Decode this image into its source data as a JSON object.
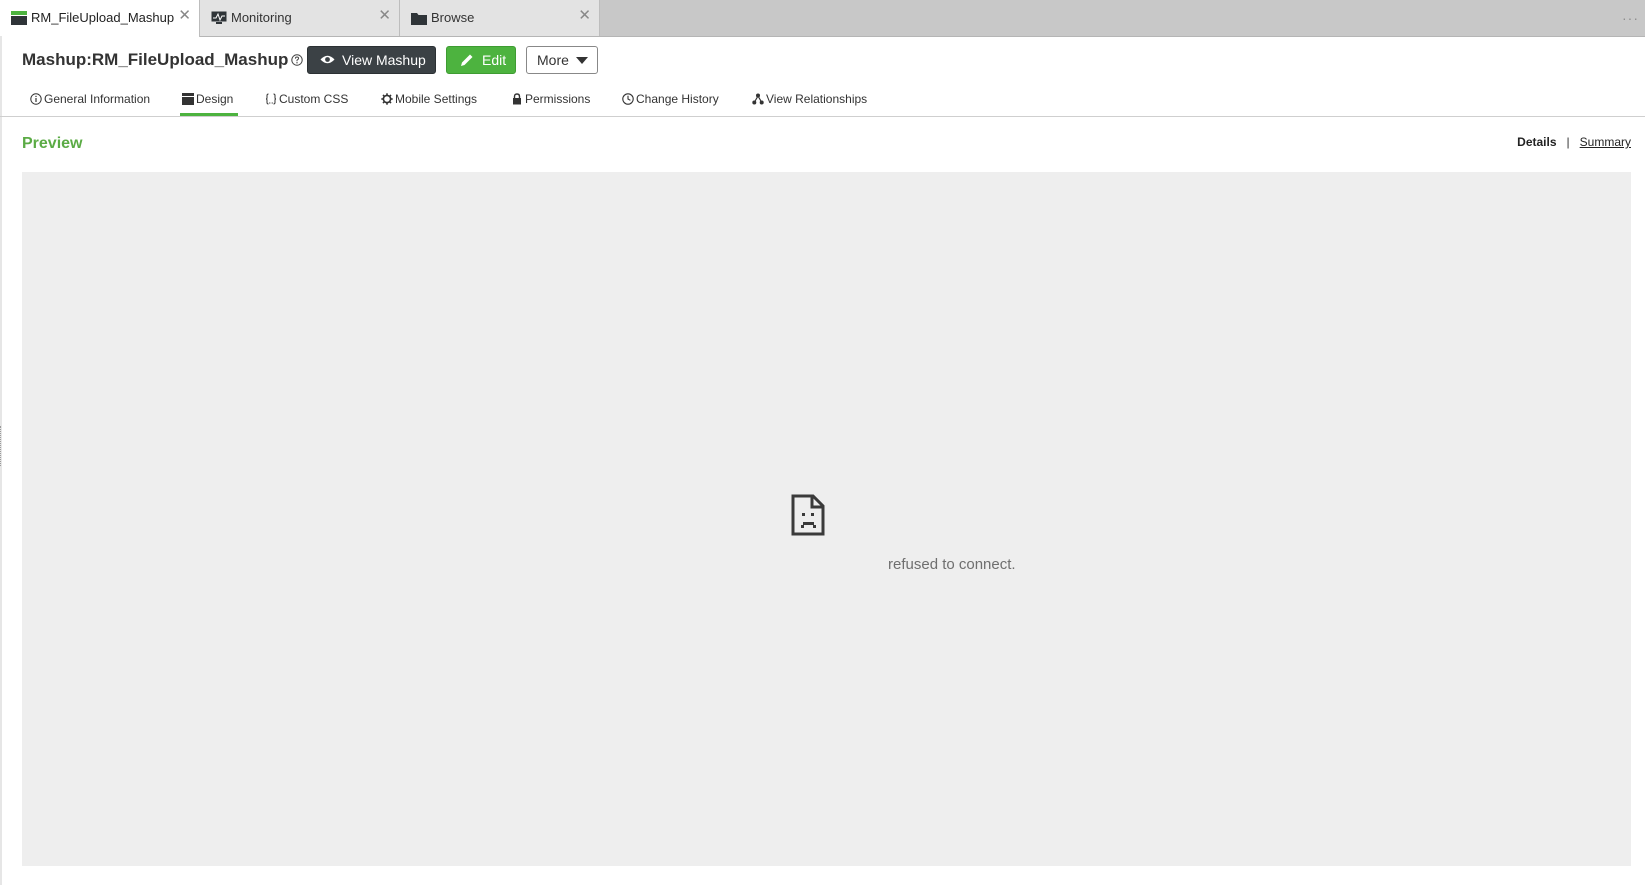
{
  "tabs": [
    {
      "label": "RM_FileUpload_Mashup",
      "icon": "mashup-icon",
      "active": true
    },
    {
      "label": "Monitoring",
      "icon": "monitor-icon",
      "active": false
    },
    {
      "label": "Browse",
      "icon": "folder-icon",
      "active": false
    }
  ],
  "tab_close_glyph": "✕",
  "overflow_glyph": "···",
  "header": {
    "title": "Mashup:RM_FileUpload_Mashup",
    "view_button": "View Mashup",
    "edit_button": "Edit",
    "more_button": "More"
  },
  "subtabs": [
    {
      "label": "General Information",
      "icon": "info-icon"
    },
    {
      "label": "Design",
      "icon": "design-icon",
      "active": true
    },
    {
      "label": "Custom CSS",
      "icon": "css-braces-icon"
    },
    {
      "label": "Mobile Settings",
      "icon": "gear-icon"
    },
    {
      "label": "Permissions",
      "icon": "lock-icon"
    },
    {
      "label": "Change History",
      "icon": "clock-icon"
    },
    {
      "label": "View Relationships",
      "icon": "relationships-icon"
    }
  ],
  "preview": {
    "title": "Preview",
    "details_label": "Details",
    "separator": "|",
    "summary_label": "Summary",
    "error_message": "refused to connect."
  },
  "colors": {
    "accent_green": "#4db33f",
    "preview_title": "#5bab45",
    "dark_button": "#3b4145",
    "frame_bg": "#eeeeee"
  }
}
